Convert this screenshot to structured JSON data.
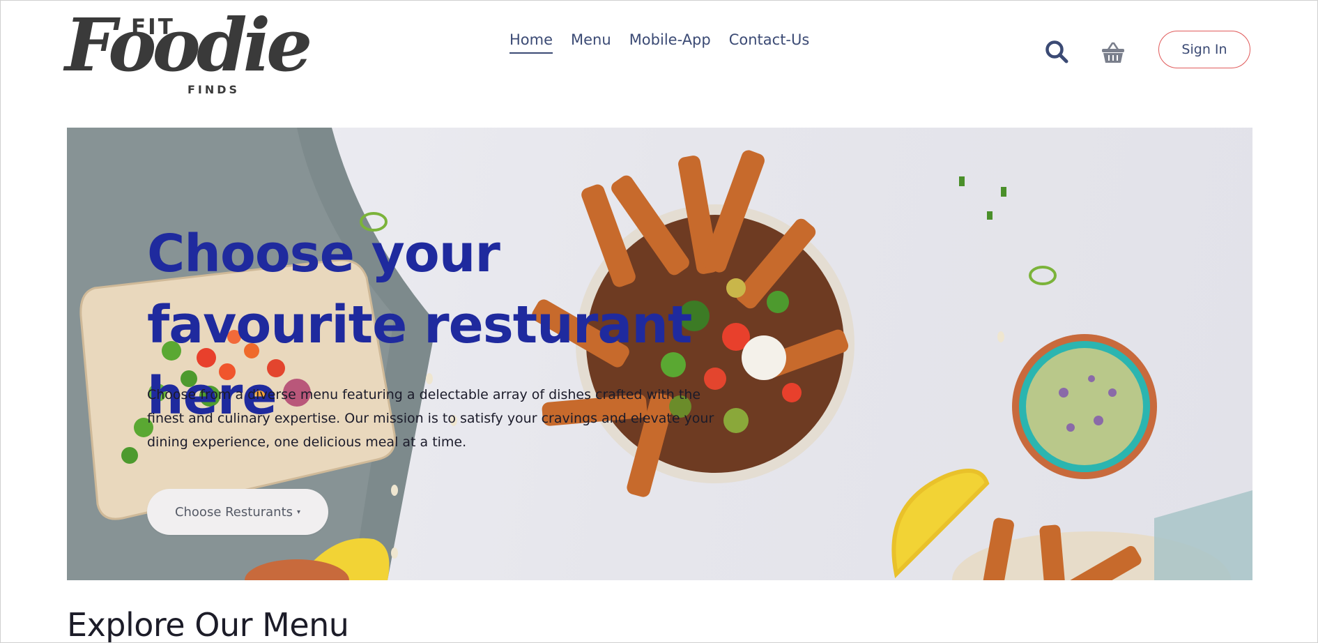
{
  "brand": {
    "logo_fit": "FIT",
    "logo_foodie": "Foodie",
    "logo_finds": "FINDS"
  },
  "nav": {
    "items": [
      {
        "label": "Home",
        "active": true
      },
      {
        "label": "Menu",
        "active": false
      },
      {
        "label": "Mobile-App",
        "active": false
      },
      {
        "label": "Contact-Us",
        "active": false
      }
    ]
  },
  "header": {
    "search_icon": "search-icon",
    "cart_icon": "basket-icon",
    "signin_label": "Sign In"
  },
  "hero": {
    "title": "Choose your favourite resturant here",
    "description": "Choose from a diverse menu featuring a delectable array of dishes crafted with the finest and culinary expertise. Our mission is to satisfy your cravings and elevate your dining experience, one delicious meal at a time.",
    "button_label": "Choose Resturants",
    "button_caret": "▾"
  },
  "explore": {
    "title": "Explore Our Menu"
  },
  "colors": {
    "nav_text": "#3b4a74",
    "hero_title": "#1f2a9e",
    "signin_border": "#e05a5a"
  }
}
